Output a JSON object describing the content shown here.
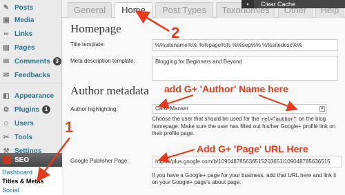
{
  "sidebar": {
    "items": [
      {
        "label": "Posts",
        "icon": "pin-icon"
      },
      {
        "label": "Media",
        "icon": "media-icon"
      },
      {
        "label": "Links",
        "icon": "link-icon"
      },
      {
        "label": "Pages",
        "icon": "page-icon"
      },
      {
        "label": "Comments",
        "icon": "comment-icon",
        "badge": "3"
      },
      {
        "label": "Feedbacks",
        "icon": "feedback-icon"
      },
      {
        "label": "Appearance",
        "icon": "appearance-icon"
      },
      {
        "label": "Plugins",
        "icon": "plugin-icon",
        "badge": "1"
      },
      {
        "label": "Users",
        "icon": "users-icon"
      },
      {
        "label": "Tools",
        "icon": "tools-icon"
      },
      {
        "label": "Settings",
        "icon": "settings-icon"
      }
    ],
    "seo": {
      "label": "SEO",
      "submenu": [
        "Dashboard",
        "Titles & Metas",
        "Social"
      ]
    }
  },
  "adminbar": {
    "clear_cache": "Clear Cache"
  },
  "tabs": [
    "General",
    "Home",
    "Post Types",
    "Taxonomies",
    "Other",
    "Help"
  ],
  "main": {
    "homepage_heading": "Homepage",
    "title_template_label": "Title template:",
    "title_template_value": "%%sitename%% %%page%% %%sep%% %%sitedesc%%",
    "meta_desc_label": "Meta description template:",
    "meta_desc_value": "Blogging for Beginners and Beyond",
    "author_heading": "Author metadata",
    "author_highlight_label": "Author highlighting:",
    "author_select_value": "Carol Manser",
    "author_desc_1": "Choose the user that should be used for the",
    "author_desc_code": "rel=\"author\"",
    "author_desc_2": "on the blog homepage. Make sure the user has filled out his/her Google+ profile link on their profile page.",
    "publisher_label": "Google Publisher Page:",
    "publisher_value": "https://plus.google.com/b/109048785636515203651/109048785636515",
    "publisher_desc": "If you have a Google+ page for your business, add that URL here and link it on your Google+ page's about page."
  },
  "annotations": {
    "num1": "1",
    "num2": "2",
    "author_note": "add G+ 'Author' Name here",
    "page_note": "Add G+ 'Page' URL Here",
    "color": "#e8391b"
  }
}
